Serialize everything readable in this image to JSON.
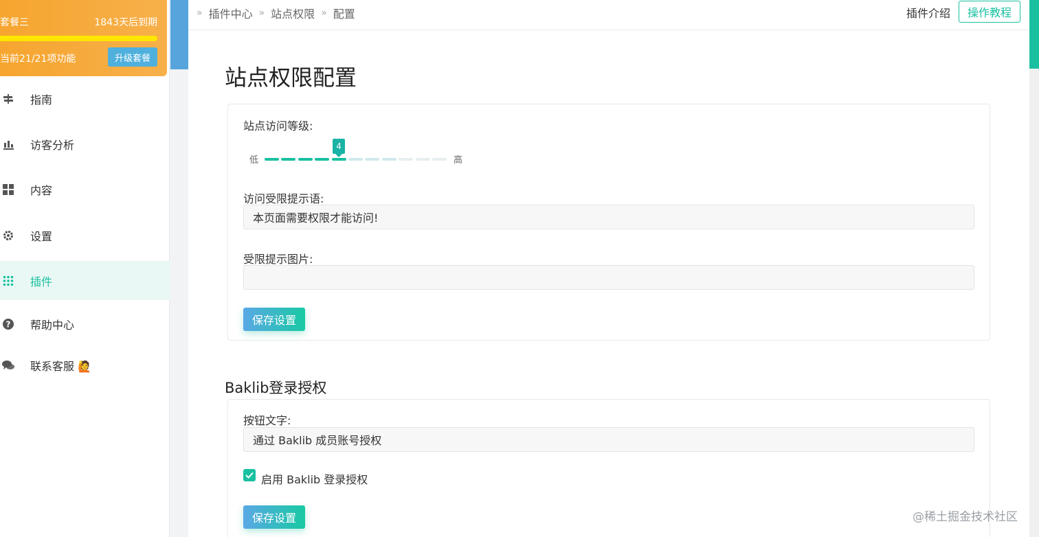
{
  "plan": {
    "name": "套餐三",
    "expire": "1843天后到期",
    "progress_fraction": 1.0,
    "features": "当前21/21项功能",
    "upgrade_label": "升级套餐"
  },
  "nav": {
    "items": [
      {
        "label": "指南",
        "icon": "signpost-icon"
      },
      {
        "label": "访客分析",
        "icon": "bar-chart-icon"
      },
      {
        "label": "内容",
        "icon": "grid-icon"
      },
      {
        "label": "设置",
        "icon": "gear-icon"
      },
      {
        "label": "插件",
        "icon": "dots-grid-icon",
        "active": true
      },
      {
        "label": "帮助中心",
        "icon": "question-icon"
      },
      {
        "label": "联系客服 🙋",
        "icon": "chat-icon"
      }
    ]
  },
  "breadcrumb": [
    "插件中心",
    "站点权限",
    "配置"
  ],
  "topbar": {
    "plugin_intro": "插件介绍",
    "tutorial": "操作教程"
  },
  "page_title": "站点权限配置",
  "access": {
    "level_label": "站点访问等级:",
    "level_low": "低",
    "level_high": "高",
    "level_value": "4",
    "level_max": 11,
    "message_label": "访问受限提示语:",
    "message_value": "本页面需要权限才能访问!",
    "image_label": "受限提示图片:",
    "image_value": "",
    "save_label": "保存设置"
  },
  "baklib": {
    "title": "Baklib登录授权",
    "button_text_label": "按钮文字:",
    "button_text_value": "通过 Baklib 成员账号授权",
    "enable_label": "启用 Baklib 登录授权",
    "enabled": true,
    "save_label": "保存设置"
  },
  "watermark": "@稀土掘金技术社区",
  "colors": {
    "accent": "#19c0a0",
    "plan_orange": "#f6a52f",
    "progress_yellow": "#ffe600",
    "blue": "#57a4dc"
  }
}
